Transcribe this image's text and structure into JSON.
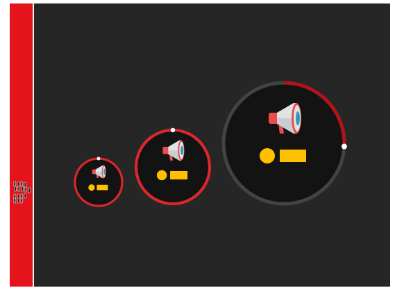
{
  "colors": {
    "background": "#262626",
    "sidebar": "#e5141c",
    "circle_fill": "#131313",
    "ring_track": "#434343",
    "ring_red": "#e0262b",
    "ring_dark_red": "#b01318",
    "handle": "#ffffff",
    "accent_yellow": "#ffc000",
    "megaphone_red": "#ef4b4b",
    "megaphone_body": "#dfe3e6",
    "megaphone_teal": "#2a9cb5"
  },
  "sidebar": {
    "logo_icon": "grid-of-figures-icon"
  },
  "widgets": [
    {
      "name": "announcement-widget-small",
      "icon": "megaphone-icon",
      "ring_progress": 1.0,
      "ring_style": "red"
    },
    {
      "name": "announcement-widget-medium",
      "icon": "megaphone-icon",
      "ring_progress": 1.0,
      "ring_style": "red"
    },
    {
      "name": "announcement-widget-large",
      "icon": "megaphone-icon",
      "ring_progress": 0.26,
      "ring_style": "dark-red"
    }
  ]
}
